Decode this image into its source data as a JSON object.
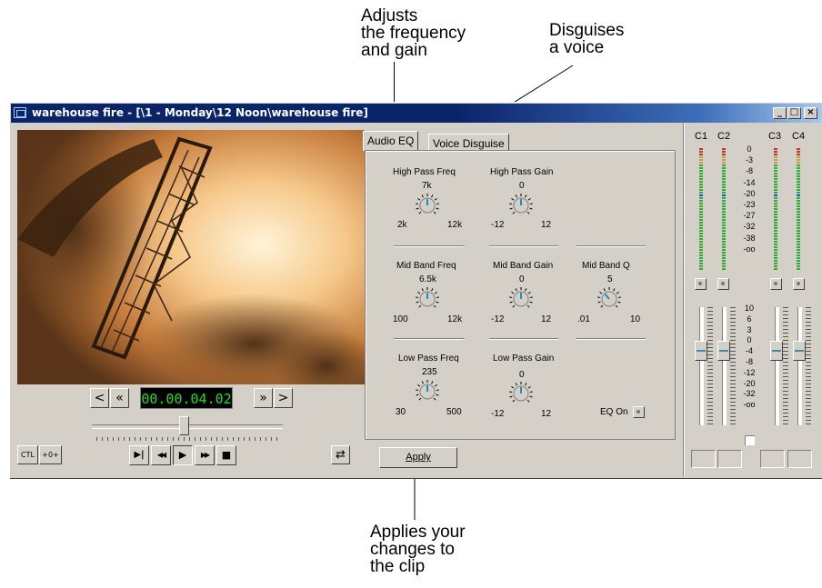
{
  "callouts": {
    "eq": "Adjusts\nthe frequency\nand gain",
    "voice": "Disguises\na voice",
    "apply": "Applies your\nchanges to\nthe clip"
  },
  "window": {
    "title": "warehouse fire - [\\1 - Monday\\12 Noon\\warehouse fire]",
    "controls": [
      "_",
      "□",
      "×"
    ]
  },
  "player": {
    "timecode": "00.00.04.02",
    "prev_frame": "<",
    "rewind_fast": "«",
    "forward_fast": "»",
    "next_frame": ">",
    "ctl_label": "CTL",
    "offset_label": "+0+",
    "play_selection": "▶|",
    "rewind": "◀◀",
    "play": "▶",
    "fast_forward": "▶▶",
    "stop": "■",
    "loop": "⇄",
    "scrub_position": 0.48
  },
  "tabs": [
    "Audio EQ",
    "Voice Disguise"
  ],
  "eq": {
    "high_pass_freq": {
      "label": "High Pass Freq",
      "value": "7k",
      "min": "2k",
      "max": "12k",
      "level": 0.5
    },
    "high_pass_gain": {
      "label": "High Pass Gain",
      "value": "0",
      "min": "-12",
      "max": "12",
      "level": 0.5
    },
    "mid_band_freq": {
      "label": "Mid Band Freq",
      "value": "6.5k",
      "min": "100",
      "max": "12k",
      "level": 0.5
    },
    "mid_band_gain": {
      "label": "Mid Band Gain",
      "value": "0",
      "min": "-12",
      "max": "12",
      "level": 0.5
    },
    "mid_band_q": {
      "label": "Mid Band Q",
      "value": "5",
      "min": ".01",
      "max": "10",
      "level": 0.35
    },
    "low_pass_freq": {
      "label": "Low Pass Freq",
      "value": "235",
      "min": "30",
      "max": "500",
      "level": 0.5
    },
    "low_pass_gain": {
      "label": "Low Pass Gain",
      "value": "0",
      "min": "-12",
      "max": "12",
      "level": 0.5
    },
    "eq_on_label": "EQ On"
  },
  "apply_label": "Apply",
  "meters": {
    "channels": [
      "C1",
      "C2",
      "C3",
      "C4"
    ],
    "meter_scale": [
      "0",
      "-3",
      "-8",
      "-14",
      "-20",
      "-23",
      "-27",
      "-32",
      "-38",
      "-oo"
    ],
    "fader_scale": [
      "10",
      "6",
      "3",
      "0",
      "-4",
      "-8",
      "-12",
      "-20",
      "-32",
      "-oo"
    ],
    "fader_db": [
      0,
      0,
      0,
      0
    ]
  },
  "colors": {
    "window_bg": "#d4d0c8",
    "title_bar": "#0a246a",
    "timecode_text": "#22dd22",
    "meter_green": "#2fae3a",
    "meter_red": "#c0392b",
    "meter_blue": "#1f4fd6"
  }
}
